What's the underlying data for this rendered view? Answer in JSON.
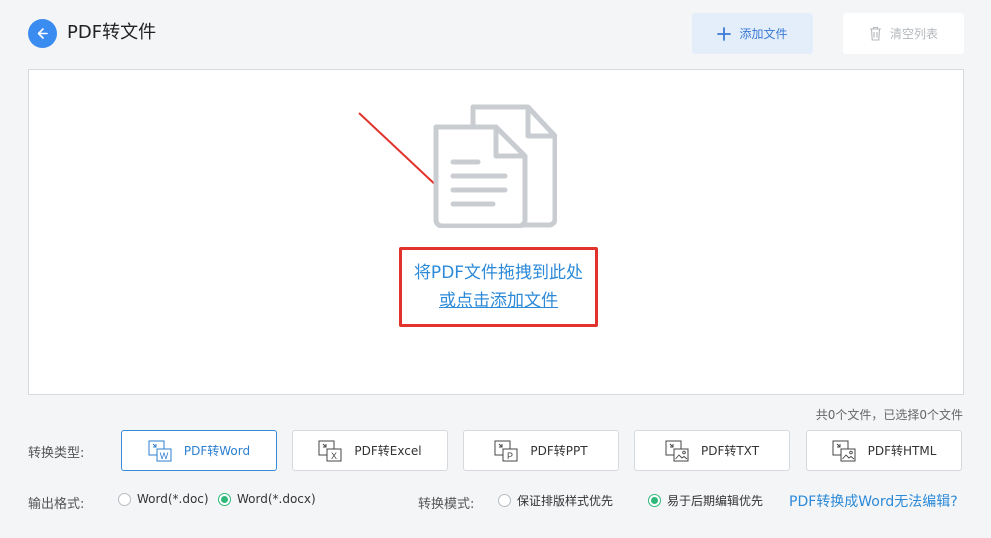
{
  "header": {
    "title": "PDF转文件",
    "add_file_label": "添加文件",
    "clear_list_label": "清空列表"
  },
  "drop_area": {
    "hint_line1": "将PDF文件拖拽到此处",
    "hint_line2": "或点击添加文件"
  },
  "file_count": "共0个文件，已选择0个文件",
  "conversion_type": {
    "label": "转换类型:",
    "options": [
      {
        "label": "PDF转Word",
        "icon": "word-file-icon",
        "letter": "W",
        "active": true
      },
      {
        "label": "PDF转Excel",
        "icon": "excel-file-icon",
        "letter": "X",
        "active": false
      },
      {
        "label": "PDF转PPT",
        "icon": "ppt-file-icon",
        "letter": "P",
        "active": false
      },
      {
        "label": "PDF转TXT",
        "icon": "txt-file-icon",
        "letter": "",
        "active": false
      },
      {
        "label": "PDF转HTML",
        "icon": "html-file-icon",
        "letter": "",
        "active": false
      }
    ]
  },
  "output_format": {
    "label": "输出格式:",
    "options": [
      {
        "label": "Word(*.doc)",
        "checked": false
      },
      {
        "label": "Word(*.docx)",
        "checked": true
      }
    ]
  },
  "conversion_mode": {
    "label": "转换模式:",
    "options": [
      {
        "label": "保证排版样式优先",
        "checked": false
      },
      {
        "label": "易于后期编辑优先",
        "checked": true
      }
    ]
  },
  "help_link": "PDF转换成Word无法编辑?",
  "colors": {
    "accent": "#3b8cf0",
    "link": "#2c8ad8",
    "highlight_box": "#e2322c",
    "radio_checked": "#2fb87a"
  }
}
